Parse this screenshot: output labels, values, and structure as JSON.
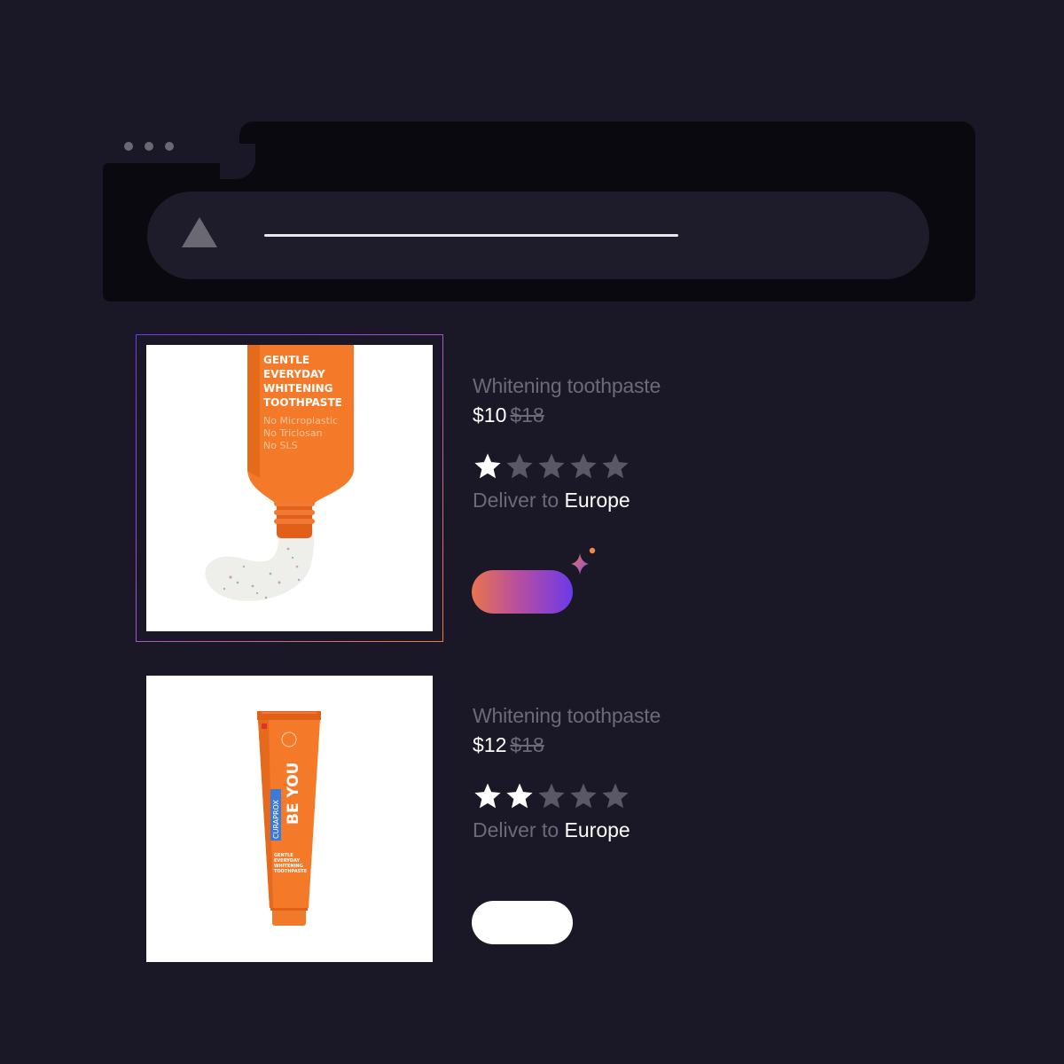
{
  "browser": {
    "address_bar_icon": "warning-triangle-icon"
  },
  "products": [
    {
      "title": "Whitening toothpaste",
      "price": "$10",
      "old_price": "$18",
      "rating": 1,
      "rating_max": 5,
      "delivery_label": "Deliver to",
      "delivery_region": "Europe",
      "selected": true,
      "image": {
        "tube_lines": [
          "GENTLE",
          "EVERYDAY",
          "WHITENING",
          "TOOTHPASTE"
        ],
        "tube_sub_lines": [
          "No Microplastic",
          "No Triclosan",
          "No SLS"
        ]
      }
    },
    {
      "title": "Whitening toothpaste",
      "price": "$12",
      "old_price": "$18",
      "rating": 2,
      "rating_max": 5,
      "delivery_label": "Deliver to",
      "delivery_region": "Europe",
      "selected": false,
      "image": {
        "brand": "CURAPROX",
        "product_name": "BE YOU",
        "tube_lines": [
          "GENTLE",
          "EVERYDAY",
          "WHITENING",
          "TOOTHPASTE"
        ]
      }
    }
  ],
  "colors": {
    "background": "#1a1826",
    "chrome": "#0a090f",
    "address_bar": "#1e1c2b",
    "muted_text": "#6c6a78",
    "star_filled": "#ffffff",
    "star_empty": "#5a5866",
    "tube_orange": "#f47a2a",
    "accent_orange": "#e8744e",
    "accent_purple": "#6c3ae8"
  }
}
